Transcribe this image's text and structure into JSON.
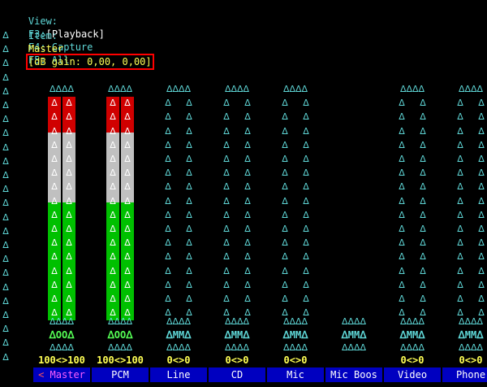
{
  "header": {
    "view_label": "View:",
    "f3": "F3:",
    "playback": "[Playback]",
    "f4_capture": "F4: Capture",
    "f5_all": "F5: All",
    "item_label": "Item:",
    "item_name": "Master",
    "item_gain": "[dB gain: 0,00, 0,00]"
  },
  "edge_glyph": "ᐃ",
  "channels": [
    {
      "name": "Master",
      "selected": true,
      "volume": "100<>100",
      "left_pct": 100,
      "right_pct": 100,
      "mute": "OO",
      "has_capture_toggle": false,
      "has_full_frame": true
    },
    {
      "name": "PCM",
      "selected": false,
      "volume": "100<>100",
      "left_pct": 100,
      "right_pct": 100,
      "mute": "OO",
      "has_capture_toggle": false,
      "has_full_frame": true
    },
    {
      "name": "Line",
      "selected": false,
      "volume": "0<>0",
      "left_pct": 0,
      "right_pct": 0,
      "mute": "MM",
      "has_capture_toggle": false,
      "has_full_frame": true
    },
    {
      "name": "CD",
      "selected": false,
      "volume": "0<>0",
      "left_pct": 0,
      "right_pct": 0,
      "mute": "MM",
      "has_capture_toggle": false,
      "has_full_frame": true
    },
    {
      "name": "Mic",
      "selected": false,
      "volume": "0<>0",
      "left_pct": 0,
      "right_pct": 0,
      "mute": "MM",
      "has_capture_toggle": false,
      "has_full_frame": true
    },
    {
      "name": "Mic Boos",
      "selected": false,
      "volume": "",
      "left_pct": 0,
      "right_pct": 0,
      "mute": "MM",
      "has_capture_toggle": false,
      "has_full_frame": false
    },
    {
      "name": "Video",
      "selected": false,
      "volume": "0<>0",
      "left_pct": 0,
      "right_pct": 0,
      "mute": "MM",
      "has_capture_toggle": false,
      "has_full_frame": true
    },
    {
      "name": "Phone",
      "selected": false,
      "volume": "0<>0",
      "left_pct": 0,
      "right_pct": 0,
      "mute": "MM",
      "has_capture_toggle": false,
      "has_full_frame": true
    }
  ],
  "selection_arrows": {
    "left": "<",
    "right": ">"
  },
  "colors": {
    "bar_green": "#00c000",
    "bar_white": "#c0c0c0",
    "bar_red": "#d00000",
    "tab_bg": "#0000c0",
    "highlight": "#ff0000"
  }
}
